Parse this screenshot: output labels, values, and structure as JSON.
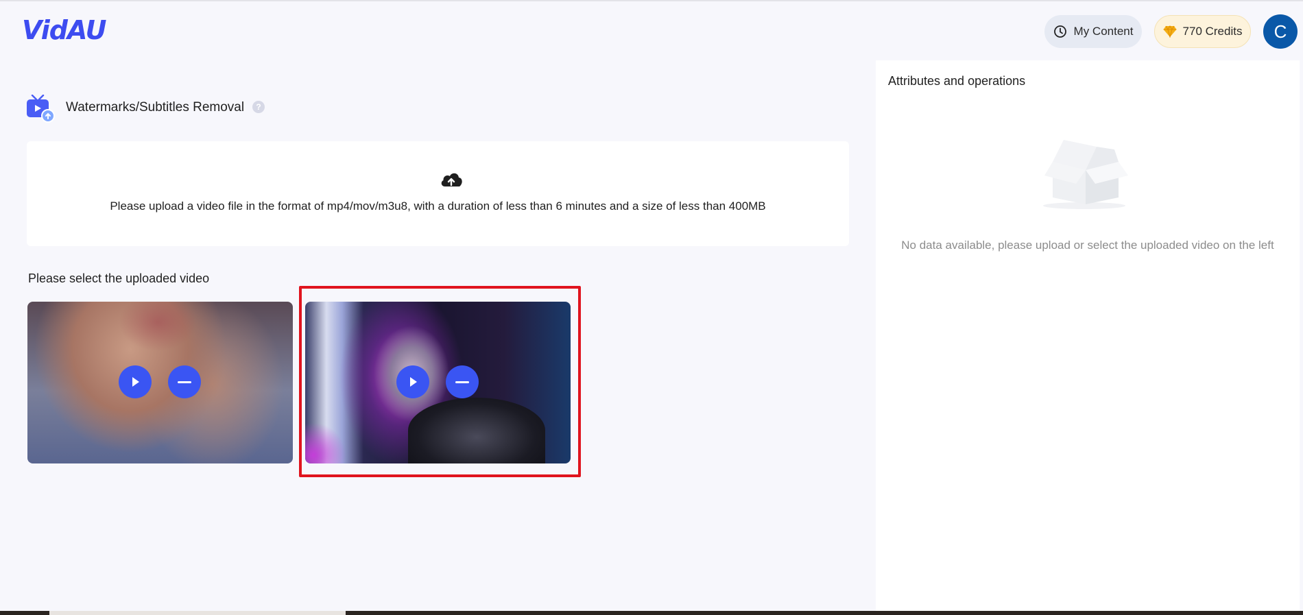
{
  "header": {
    "logo_text": "VidAU",
    "my_content_label": "My Content",
    "my_content_icon": "clock-icon",
    "credits_label": "770 Credits",
    "credits_icon": "diamond-icon",
    "avatar_letter": "C"
  },
  "tool": {
    "title": "Watermarks/Subtitles Removal",
    "help_glyph": "?",
    "upload_hint": "Please upload a video file in the format of mp4/mov/m3u8, with a duration of less than 6 minutes and a size of less than 400MB"
  },
  "uploaded": {
    "section_label": "Please select the uploaded video",
    "videos": [
      {
        "play_icon": "play-icon",
        "remove_icon": "minus-icon"
      },
      {
        "play_icon": "play-icon",
        "remove_icon": "minus-icon"
      }
    ]
  },
  "right_panel": {
    "title": "Attributes and operations",
    "empty_text": "No data available, please upload or select the uploaded video on the left"
  },
  "colors": {
    "brand": "#3d4cf0",
    "button_blue": "#3a55f3",
    "highlight": "#e0141e",
    "credits_bg": "#fdf3dc",
    "avatar_bg": "#0a58a8"
  }
}
